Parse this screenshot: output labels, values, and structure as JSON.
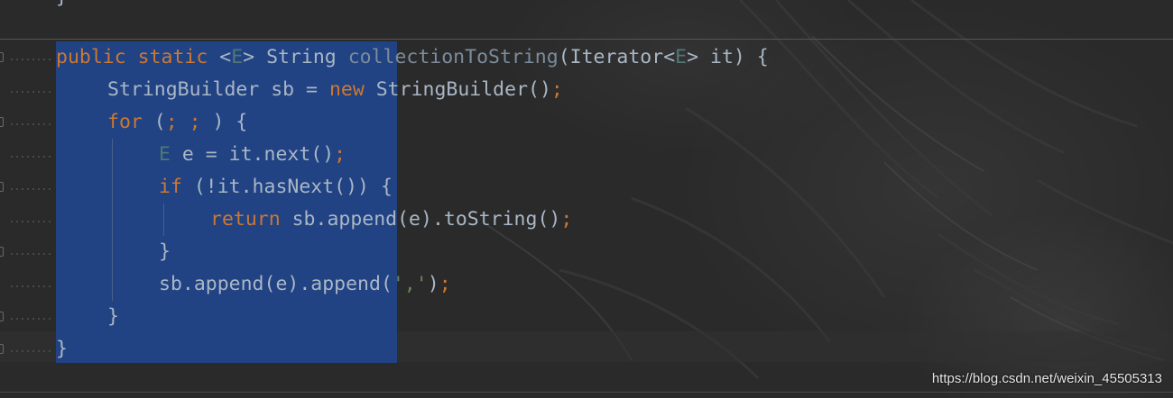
{
  "editor": {
    "top_fragment": "}",
    "lines": [
      {
        "indent": 0,
        "tokens": [
          {
            "t": "public",
            "k": "kw"
          },
          {
            "t": " "
          },
          {
            "t": "static",
            "k": "kw"
          },
          {
            "t": " "
          },
          {
            "t": "<",
            "k": "punct"
          },
          {
            "t": "E",
            "k": "tparam"
          },
          {
            "t": ">",
            "k": "punct"
          },
          {
            "t": " "
          },
          {
            "t": "String",
            "k": "typ"
          },
          {
            "t": " "
          },
          {
            "t": "collectionToString",
            "k": "fn"
          },
          {
            "t": "(",
            "k": "punct"
          },
          {
            "t": "Iterator",
            "k": "typ"
          },
          {
            "t": "<",
            "k": "punct"
          },
          {
            "t": "E",
            "k": "tparam"
          },
          {
            "t": ">",
            "k": "punct"
          },
          {
            "t": " it) {",
            "k": "punct"
          }
        ]
      },
      {
        "indent": 1,
        "tokens": [
          {
            "t": "StringBuilder sb = ",
            "k": "typ"
          },
          {
            "t": "new",
            "k": "kw"
          },
          {
            "t": " StringBuilder()",
            "k": "typ"
          },
          {
            "t": ";",
            "k": "semi"
          }
        ]
      },
      {
        "indent": 1,
        "tokens": [
          {
            "t": "for",
            "k": "kw"
          },
          {
            "t": " (",
            "k": "punct"
          },
          {
            "t": ";",
            "k": "semi"
          },
          {
            "t": " "
          },
          {
            "t": ";",
            "k": "semi"
          },
          {
            "t": " ) {",
            "k": "punct"
          }
        ]
      },
      {
        "indent": 2,
        "tokens": [
          {
            "t": "E",
            "k": "tparam"
          },
          {
            "t": " e = it.next()",
            "k": "typ"
          },
          {
            "t": ";",
            "k": "semi"
          }
        ]
      },
      {
        "indent": 2,
        "tokens": [
          {
            "t": "if",
            "k": "kw"
          },
          {
            "t": " (!it.hasNext()) {",
            "k": "punct"
          }
        ]
      },
      {
        "indent": 3,
        "tokens": [
          {
            "t": "return",
            "k": "kw"
          },
          {
            "t": " sb.append(e).toString()",
            "k": "typ"
          },
          {
            "t": ";",
            "k": "semi"
          }
        ]
      },
      {
        "indent": 2,
        "tokens": [
          {
            "t": "}",
            "k": "punct"
          }
        ]
      },
      {
        "indent": 2,
        "tokens": [
          {
            "t": "sb.append(e).append(",
            "k": "typ"
          },
          {
            "t": "','",
            "k": "str"
          },
          {
            "t": ")",
            "k": "punct"
          },
          {
            "t": ";",
            "k": "semi"
          }
        ]
      },
      {
        "indent": 1,
        "tokens": [
          {
            "t": "}",
            "k": "punct"
          }
        ]
      },
      {
        "indent": 0,
        "tokens": [
          {
            "t": "}",
            "k": "brace-hl"
          }
        ]
      }
    ]
  },
  "watermark": "https://blog.csdn.net/weixin_45505313",
  "colors": {
    "background": "#2b2b2b",
    "selection": "#214283",
    "keyword": "#cc7832",
    "identifier": "#a9b7c6",
    "type_parameter": "#507874",
    "string": "#6a8759"
  }
}
